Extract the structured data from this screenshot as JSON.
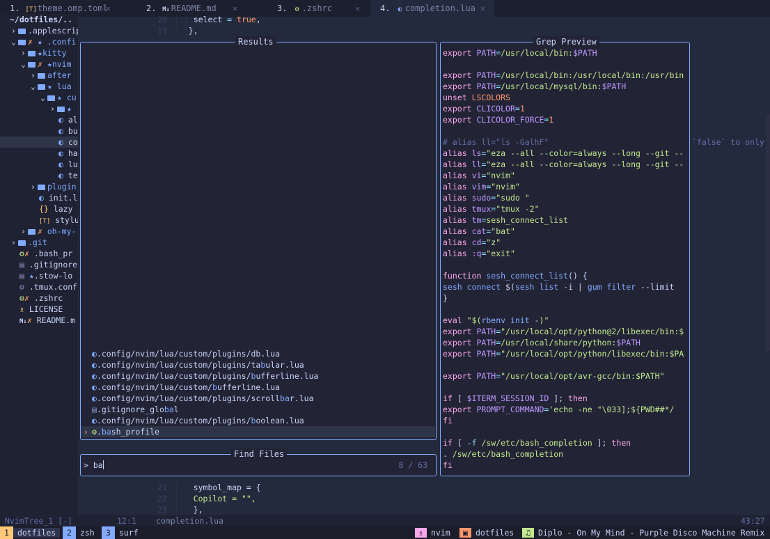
{
  "tabs": [
    {
      "num": "1.",
      "icon": "[T]",
      "name": "theme.omp.toml",
      "active": false
    },
    {
      "num": "2.",
      "icon": "M↓",
      "name": "README.md",
      "active": false
    },
    {
      "num": "3.",
      "icon": "⚙",
      "name": ".zshrc",
      "active": false
    },
    {
      "num": "4.",
      "icon": "◐",
      "name": "completion.lua",
      "active": true
    }
  ],
  "close_glyph": "✕",
  "tree": {
    "root": "~/dotfiles/..",
    "items": [
      {
        "label": ".applescripts"
      },
      {
        "label": ".confi"
      },
      {
        "label": "kitty"
      },
      {
        "label": "nvim"
      },
      {
        "label": "after"
      },
      {
        "label": "lua"
      },
      {
        "label": "cu"
      },
      {
        "label": "★"
      },
      {
        "label": "al"
      },
      {
        "label": "bu"
      },
      {
        "label": "co"
      },
      {
        "label": "ha"
      },
      {
        "label": "lu"
      },
      {
        "label": "te"
      },
      {
        "label": "plugin"
      },
      {
        "label": "init.l"
      },
      {
        "label": "lazy"
      },
      {
        "label": "stylua"
      },
      {
        "label": "oh-my-"
      },
      {
        "label": ".git"
      },
      {
        "label": ".bash_pr"
      },
      {
        "label": ".gitignore"
      },
      {
        "label": ".stow-lo"
      },
      {
        "label": ".tmux.conf"
      },
      {
        "label": ".zshrc"
      },
      {
        "label": "LICENSE"
      },
      {
        "label": "README.m"
      }
    ]
  },
  "editor_top": [
    {
      "num": "20",
      "code_a": "select",
      "code_b": " = ",
      "code_c": "true",
      "code_d": ","
    },
    {
      "num": "19",
      "code_a": "},",
      "code_b": "",
      "code_c": "",
      "code_d": ""
    }
  ],
  "editor_bottom": [
    {
      "num": "21",
      "code": "symbol_map = {"
    },
    {
      "num": "22",
      "code": "Copilot = \"\","
    },
    {
      "num": "23",
      "code": "},"
    }
  ],
  "virtual_text": "`false` to only",
  "results": {
    "title": "Results",
    "rows": [
      {
        "icon": "lua",
        "pre": ".config/nvim/lua/custom/plugins/",
        "match": "",
        "post": "db.lua"
      },
      {
        "icon": "lua",
        "pre": ".config/nvim/lua/custom/plugins/ta",
        "match": "b",
        "post": "ular.lua"
      },
      {
        "icon": "lua",
        "pre": ".config/nvim/lua/custom/plugins/",
        "match": "b",
        "post": "ufferline.lua"
      },
      {
        "icon": "lua",
        "pre": ".config/nvim/lua/custom/",
        "match": "b",
        "post": "ufferline.lua"
      },
      {
        "icon": "lua",
        "pre": ".config/nvim/lua/custom/plugins/scroll",
        "match": "ba",
        "post": "r.lua"
      },
      {
        "icon": "doc",
        "pre": ".gitignore_glo",
        "match": "ba",
        "post": "l"
      },
      {
        "icon": "lua",
        "pre": ".config/nvim/lua/custom/plugins/",
        "match": "b",
        "post": "oolean.lua"
      },
      {
        "icon": "gear",
        "pre": ".",
        "match": "ba",
        "post": "sh_profile",
        "selected": true
      }
    ]
  },
  "find": {
    "title": "Find Files",
    "prompt": ">",
    "query": "ba",
    "count": "8 / 63"
  },
  "preview": {
    "title": "Grep Preview",
    "lines": [
      [
        [
          "kw",
          "export"
        ],
        [
          "txt",
          " "
        ],
        [
          "var",
          "PATH"
        ],
        [
          "op",
          "="
        ],
        [
          "path",
          "/usr/local/bin:"
        ],
        [
          "var",
          "$PATH"
        ]
      ],
      [],
      [
        [
          "kw",
          "export"
        ],
        [
          "txt",
          " "
        ],
        [
          "var",
          "PATH"
        ],
        [
          "op",
          "="
        ],
        [
          "path",
          "/usr/local/bin:/usr/local/bin:/usr/bin"
        ]
      ],
      [
        [
          "kw",
          "export"
        ],
        [
          "txt",
          " "
        ],
        [
          "var",
          "PATH"
        ],
        [
          "op",
          "="
        ],
        [
          "path",
          "/usr/local/mysql/bin:"
        ],
        [
          "var",
          "$PATH"
        ]
      ],
      [
        [
          "kw",
          "unset"
        ],
        [
          "txt",
          " "
        ],
        [
          "org",
          "LSCOLORS"
        ]
      ],
      [
        [
          "kw",
          "export"
        ],
        [
          "txt",
          " "
        ],
        [
          "var",
          "CLICOLOR"
        ],
        [
          "op",
          "="
        ],
        [
          "org",
          "1"
        ]
      ],
      [
        [
          "kw",
          "export"
        ],
        [
          "txt",
          " "
        ],
        [
          "var",
          "CLICOLOR_FORCE"
        ],
        [
          "op",
          "="
        ],
        [
          "org",
          "1"
        ]
      ],
      [],
      [
        [
          "com",
          "# alias ll=\"ls -GalhF\""
        ]
      ],
      [
        [
          "kw",
          "alias"
        ],
        [
          "txt",
          " "
        ],
        [
          "var",
          "ls"
        ],
        [
          "op",
          "="
        ],
        [
          "str",
          "\"eza --all --color=always --long --git --"
        ]
      ],
      [
        [
          "kw",
          "alias"
        ],
        [
          "txt",
          " "
        ],
        [
          "var",
          "ll"
        ],
        [
          "op",
          "="
        ],
        [
          "str",
          "\"eza --all --color=always --long --git --"
        ]
      ],
      [
        [
          "kw",
          "alias"
        ],
        [
          "txt",
          " "
        ],
        [
          "var",
          "vi"
        ],
        [
          "op",
          "="
        ],
        [
          "str",
          "\"nvim\""
        ]
      ],
      [
        [
          "kw",
          "alias"
        ],
        [
          "txt",
          " "
        ],
        [
          "var",
          "vim"
        ],
        [
          "op",
          "="
        ],
        [
          "str",
          "\"nvim\""
        ]
      ],
      [
        [
          "kw",
          "alias"
        ],
        [
          "txt",
          " "
        ],
        [
          "var",
          "sudo"
        ],
        [
          "op",
          "="
        ],
        [
          "str",
          "\"sudo \""
        ]
      ],
      [
        [
          "kw",
          "alias"
        ],
        [
          "txt",
          " "
        ],
        [
          "var",
          "tmux"
        ],
        [
          "op",
          "="
        ],
        [
          "str",
          "\"tmux -2\""
        ]
      ],
      [
        [
          "kw",
          "alias"
        ],
        [
          "txt",
          " "
        ],
        [
          "var",
          "tm"
        ],
        [
          "op",
          "="
        ],
        [
          "str",
          "sesh_connect_list"
        ]
      ],
      [
        [
          "kw",
          "alias"
        ],
        [
          "txt",
          " "
        ],
        [
          "var",
          "cat"
        ],
        [
          "op",
          "="
        ],
        [
          "str",
          "\"bat\""
        ]
      ],
      [
        [
          "kw",
          "alias"
        ],
        [
          "txt",
          " "
        ],
        [
          "var",
          "cd"
        ],
        [
          "op",
          "="
        ],
        [
          "str",
          "\"z\""
        ]
      ],
      [
        [
          "kw",
          "alias"
        ],
        [
          "txt",
          " "
        ],
        [
          "var",
          ":q"
        ],
        [
          "op",
          "="
        ],
        [
          "str",
          "\"exit\""
        ]
      ],
      [],
      [
        [
          "kw",
          "function"
        ],
        [
          "txt",
          " "
        ],
        [
          "fn",
          "sesh_connect_list"
        ],
        [
          "txt",
          "() {"
        ]
      ],
      [
        [
          "txt",
          "  "
        ],
        [
          "fn",
          "sesh"
        ],
        [
          "txt",
          " "
        ],
        [
          "fn",
          "connect"
        ],
        [
          "txt",
          " $("
        ],
        [
          "fn",
          "sesh"
        ],
        [
          "txt",
          " "
        ],
        [
          "fn",
          "list"
        ],
        [
          "txt",
          " -i | "
        ],
        [
          "fn",
          "gum"
        ],
        [
          "txt",
          " "
        ],
        [
          "fn",
          "filter"
        ],
        [
          "txt",
          " --limit"
        ]
      ],
      [
        [
          "txt",
          "}"
        ]
      ],
      [],
      [
        [
          "kw",
          "eval"
        ],
        [
          "txt",
          " "
        ],
        [
          "str",
          "\"$("
        ],
        [
          "fn",
          "rbenv"
        ],
        [
          "txt",
          " "
        ],
        [
          "fn",
          "init"
        ],
        [
          "txt",
          " -"
        ],
        [
          "str",
          ")\""
        ]
      ],
      [
        [
          "kw",
          "export"
        ],
        [
          "txt",
          " "
        ],
        [
          "var",
          "PATH"
        ],
        [
          "op",
          "="
        ],
        [
          "str",
          "\"/usr/local/opt/python@2/libexec/bin:$"
        ]
      ],
      [
        [
          "kw",
          "export"
        ],
        [
          "txt",
          " "
        ],
        [
          "var",
          "PATH"
        ],
        [
          "op",
          "="
        ],
        [
          "path",
          "/usr/local/share/python:"
        ],
        [
          "var",
          "$PATH"
        ]
      ],
      [
        [
          "kw",
          "export"
        ],
        [
          "txt",
          " "
        ],
        [
          "var",
          "PATH"
        ],
        [
          "op",
          "="
        ],
        [
          "str",
          "\"/usr/local/opt/python/libexec/bin:$PA"
        ]
      ],
      [],
      [
        [
          "kw",
          "export"
        ],
        [
          "txt",
          " "
        ],
        [
          "var",
          "PATH"
        ],
        [
          "op",
          "="
        ],
        [
          "str",
          "\"/usr/local/opt/avr-gcc/bin:$PATH\""
        ]
      ],
      [],
      [
        [
          "kw",
          "if"
        ],
        [
          "txt",
          " [ "
        ],
        [
          "var",
          "$ITERM_SESSION_ID"
        ],
        [
          "txt",
          " ]; "
        ],
        [
          "kw",
          "then"
        ]
      ],
      [
        [
          "txt",
          "  "
        ],
        [
          "kw",
          "export"
        ],
        [
          "txt",
          " "
        ],
        [
          "var",
          "PROMPT_COMMAND"
        ],
        [
          "op",
          "="
        ],
        [
          "str",
          "'echo -ne \"\\033];${PWD##*/"
        ]
      ],
      [
        [
          "kw",
          "fi"
        ]
      ],
      [],
      [
        [
          "kw",
          "if"
        ],
        [
          "txt",
          " [ "
        ],
        [
          "op",
          "-f"
        ],
        [
          "txt",
          " "
        ],
        [
          "path",
          "/sw/etc/bash_completion"
        ],
        [
          "txt",
          " ]; "
        ],
        [
          "kw",
          "then"
        ]
      ],
      [
        [
          "txt",
          "  . "
        ],
        [
          "path",
          "/sw/etc/bash_completion"
        ]
      ],
      [
        [
          "kw",
          "fi"
        ]
      ]
    ]
  },
  "statusline": {
    "left": "NvimTree_1 [-]",
    "left_pos": "12:1",
    "file": "completion.lua",
    "right_pos": "43:27"
  },
  "tmux": {
    "windows": [
      {
        "index": "1",
        "name": "dotfiles",
        "active": true
      },
      {
        "index": "2",
        "name": "zsh",
        "active": false
      },
      {
        "index": "3",
        "name": "surf",
        "active": false
      }
    ],
    "session_label": "nvim",
    "dir_label": "dotfiles",
    "music": "Diplo - On My Mind - Purple Disco Machine Remix"
  },
  "colors": {
    "accent": "#82aaff",
    "background": "#242a3d",
    "panel": "#222436",
    "selection": "#2f3549",
    "tmux_active": "#ffc777",
    "tmux_inactive": "#82aaff"
  }
}
